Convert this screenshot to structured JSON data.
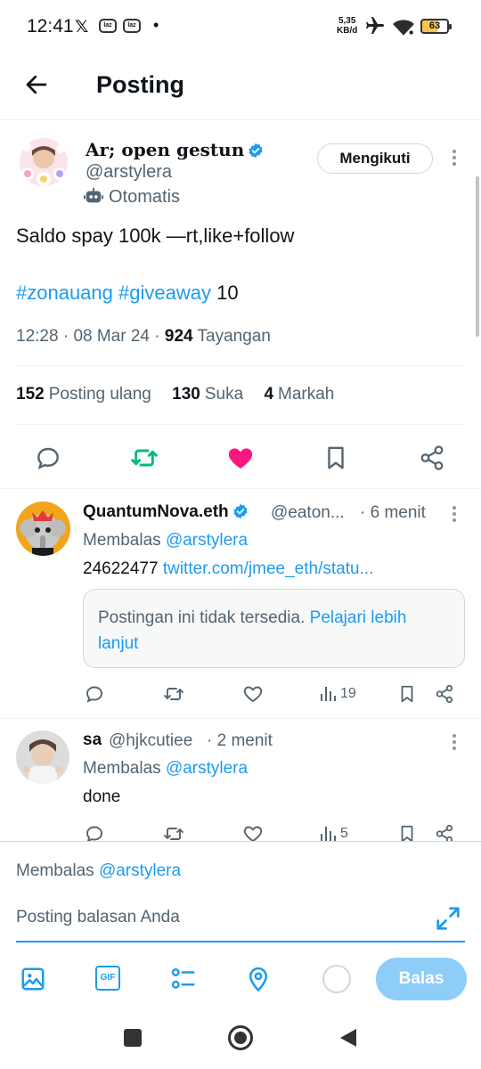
{
  "status_bar": {
    "time": "12:41",
    "x_logo": "𝕏",
    "notif_icon_1": "laz",
    "notif_icon_2": "laz",
    "dot": "•",
    "net_speed_value": "5,35",
    "net_speed_unit": "KB/d",
    "battery": "63"
  },
  "header": {
    "title": "Posting"
  },
  "post": {
    "author_name": "Ar; open gestun",
    "author_handle": "@arstylera",
    "automated_label": "Otomatis",
    "follow_label": "Mengikuti",
    "text": "Saldo spay 100k —rt,like+follow",
    "hashtag_1": "#zonauang",
    "hashtag_2": "#giveaway",
    "tag_suffix": "10",
    "time": "12:28",
    "date": "08 Mar 24",
    "views_count": "924",
    "views_label": "Tayangan",
    "reposts_count": "152",
    "reposts_label": "Posting ulang",
    "likes_count": "130",
    "likes_label": "Suka",
    "bookmarks_count": "4",
    "bookmarks_label": "Markah"
  },
  "replies": [
    {
      "name": "QuantumNova.eth",
      "handle": "@eaton...",
      "time": "· 6 menit",
      "replying_prefix": "Membalas",
      "replying_to": "@arstylera",
      "text_number": "24622477",
      "link": "twitter.com/jmee_eth/statu...",
      "embed_text": "Postingan ini tidak tersedia.",
      "embed_link": "Pelajari lebih lanjut",
      "views": "19"
    },
    {
      "name": "sa",
      "handle": "@hjkcutiee",
      "time": "· 2 menit",
      "replying_prefix": "Membalas",
      "replying_to": "@arstylera",
      "text": "done",
      "views": "5"
    }
  ],
  "compose": {
    "replying_prefix": "Membalas",
    "replying_to": "@arstylera",
    "placeholder": "Posting balasan Anda",
    "submit_label": "Balas",
    "gif_label": "GIF"
  },
  "colors": {
    "accent": "#1d9bf0",
    "repost_active": "#00ba7c",
    "like_active": "#f91880",
    "reply_button_disabled": "#8ecdf8"
  }
}
